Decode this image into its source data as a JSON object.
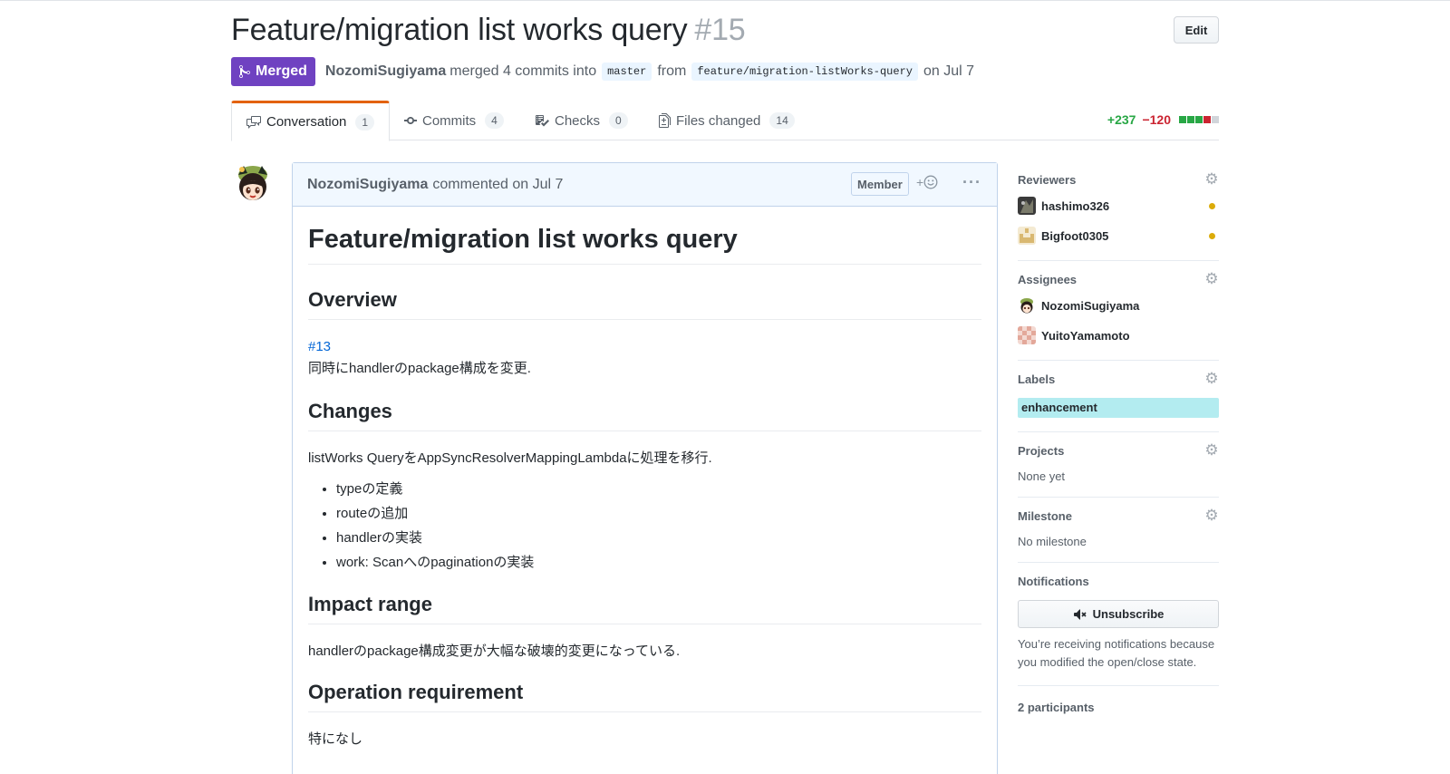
{
  "pr": {
    "title": "Feature/migration list works query",
    "number": "#15",
    "edit_label": "Edit",
    "status": "Merged",
    "author": "NozomiSugiyama",
    "merge_text": "merged 4 commits into",
    "base_branch": "master",
    "from_text": "from",
    "head_branch": "feature/migration-listWorks-query",
    "date_text": "on Jul 7"
  },
  "tabs": [
    {
      "label": "Conversation",
      "count": "1"
    },
    {
      "label": "Commits",
      "count": "4"
    },
    {
      "label": "Checks",
      "count": "0"
    },
    {
      "label": "Files changed",
      "count": "14"
    }
  ],
  "diffstat": {
    "additions": "+237",
    "deletions": "−120",
    "blocks": [
      "#28a745",
      "#28a745",
      "#28a745",
      "#cb2431",
      "#d1d5da"
    ]
  },
  "comment": {
    "author": "NozomiSugiyama",
    "action": "commented on Jul 7",
    "role_badge": "Member",
    "react_plus": "+",
    "more": "···",
    "h1": "Feature/migration list works query",
    "sections": {
      "overview": {
        "heading": "Overview",
        "link": "#13",
        "text": "同時にhandlerのpackage構成を変更."
      },
      "changes": {
        "heading": "Changes",
        "text": "listWorks QueryをAppSyncResolverMappingLambdaに処理を移行.",
        "items": [
          "typeの定義",
          "routeの追加",
          "handlerの実装",
          "work: Scanへのpaginationの実装"
        ]
      },
      "impact": {
        "heading": "Impact range",
        "text": "handlerのpackage構成変更が大幅な破壊的変更になっている."
      },
      "operation": {
        "heading": "Operation requirement",
        "text": "特になし"
      }
    }
  },
  "sidebar": {
    "reviewers": {
      "heading": "Reviewers",
      "users": [
        "hashimo326",
        "Bigfoot0305"
      ]
    },
    "assignees": {
      "heading": "Assignees",
      "users": [
        "NozomiSugiyama",
        "YuitoYamamoto"
      ]
    },
    "labels": {
      "heading": "Labels",
      "items": [
        "enhancement"
      ],
      "label_color": "#b3ecf0"
    },
    "projects": {
      "heading": "Projects",
      "value": "None yet"
    },
    "milestone": {
      "heading": "Milestone",
      "value": "No milestone"
    },
    "notifications": {
      "heading": "Notifications",
      "button": "Unsubscribe",
      "reason": "You’re receiving notifications because you modified the open/close state."
    },
    "participants": "2 participants"
  },
  "colors": {
    "merged": "#6f42c1",
    "link": "#0366d6",
    "tab_accent": "#e36209",
    "review_pending": "#dbab09"
  }
}
